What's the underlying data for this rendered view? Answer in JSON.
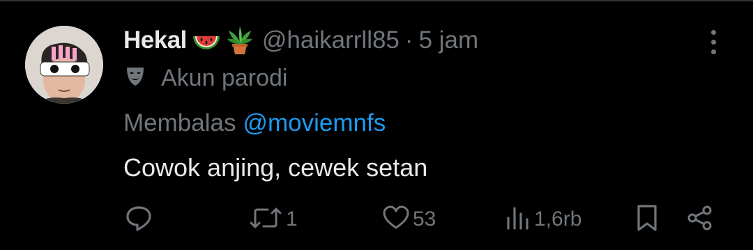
{
  "tweet": {
    "display_name": "Hekal",
    "handle": "@haikarrll85",
    "separator": "·",
    "time": "5 jam",
    "badge_label": "Akun parodi",
    "reply_prefix": "Membalas",
    "reply_to": "@moviemnfs",
    "text": "Cowok anjing, cewek setan"
  },
  "actions": {
    "reply_count": "",
    "retweet_count": "1",
    "like_count": "53",
    "view_count": "1,6rb"
  },
  "emojis": [
    "watermelon-icon",
    "potted-plant-icon"
  ],
  "colors": {
    "background": "#000000",
    "text_primary": "#e7e9ea",
    "text_secondary": "#71767b",
    "link": "#1d9bf0"
  }
}
